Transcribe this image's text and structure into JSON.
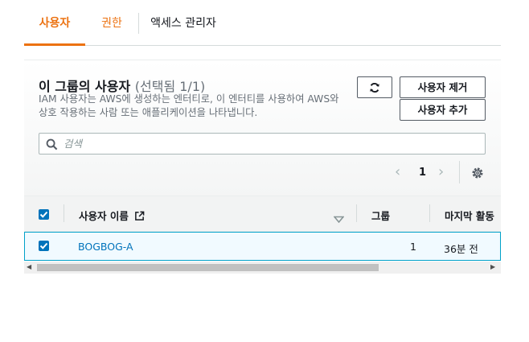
{
  "tabs": [
    "사용자",
    "권한",
    "액세스 관리자"
  ],
  "panel": {
    "title": "이 그룹의 사용자",
    "selection": "(선택됨 1/1)",
    "description": "IAM 사용자는 AWS에 생성하는 엔터티로, 이 엔터티를 사용하여 AWS와 상호 작용하는 사람 또는 애플리케이션을 나타냅니다.",
    "buttons": {
      "remove": "사용자 제거",
      "add": "사용자 추가"
    },
    "search": {
      "placeholder": "검색"
    },
    "pagination": {
      "current_page": "1"
    }
  },
  "table": {
    "columns": [
      "사용자 이름",
      "그룹",
      "마지막 활동"
    ],
    "rows": [
      {
        "selected": true,
        "username": "BOGBOG-A",
        "groups": "1",
        "last_activity": "36분 전"
      }
    ]
  },
  "colors": {
    "accent": "#ec7211",
    "link": "#0073bb",
    "checkbox": "#0073bb",
    "row_selected_bg": "#f1faff",
    "row_selected_border": "#00a1c9"
  },
  "icons": [
    "refresh-icon",
    "search-icon",
    "chevron-left-icon",
    "chevron-right-icon",
    "gear-icon",
    "external-link-icon",
    "sort-down-icon",
    "checkbox-checked-icon",
    "scroll-left-icon",
    "scroll-right-icon"
  ]
}
